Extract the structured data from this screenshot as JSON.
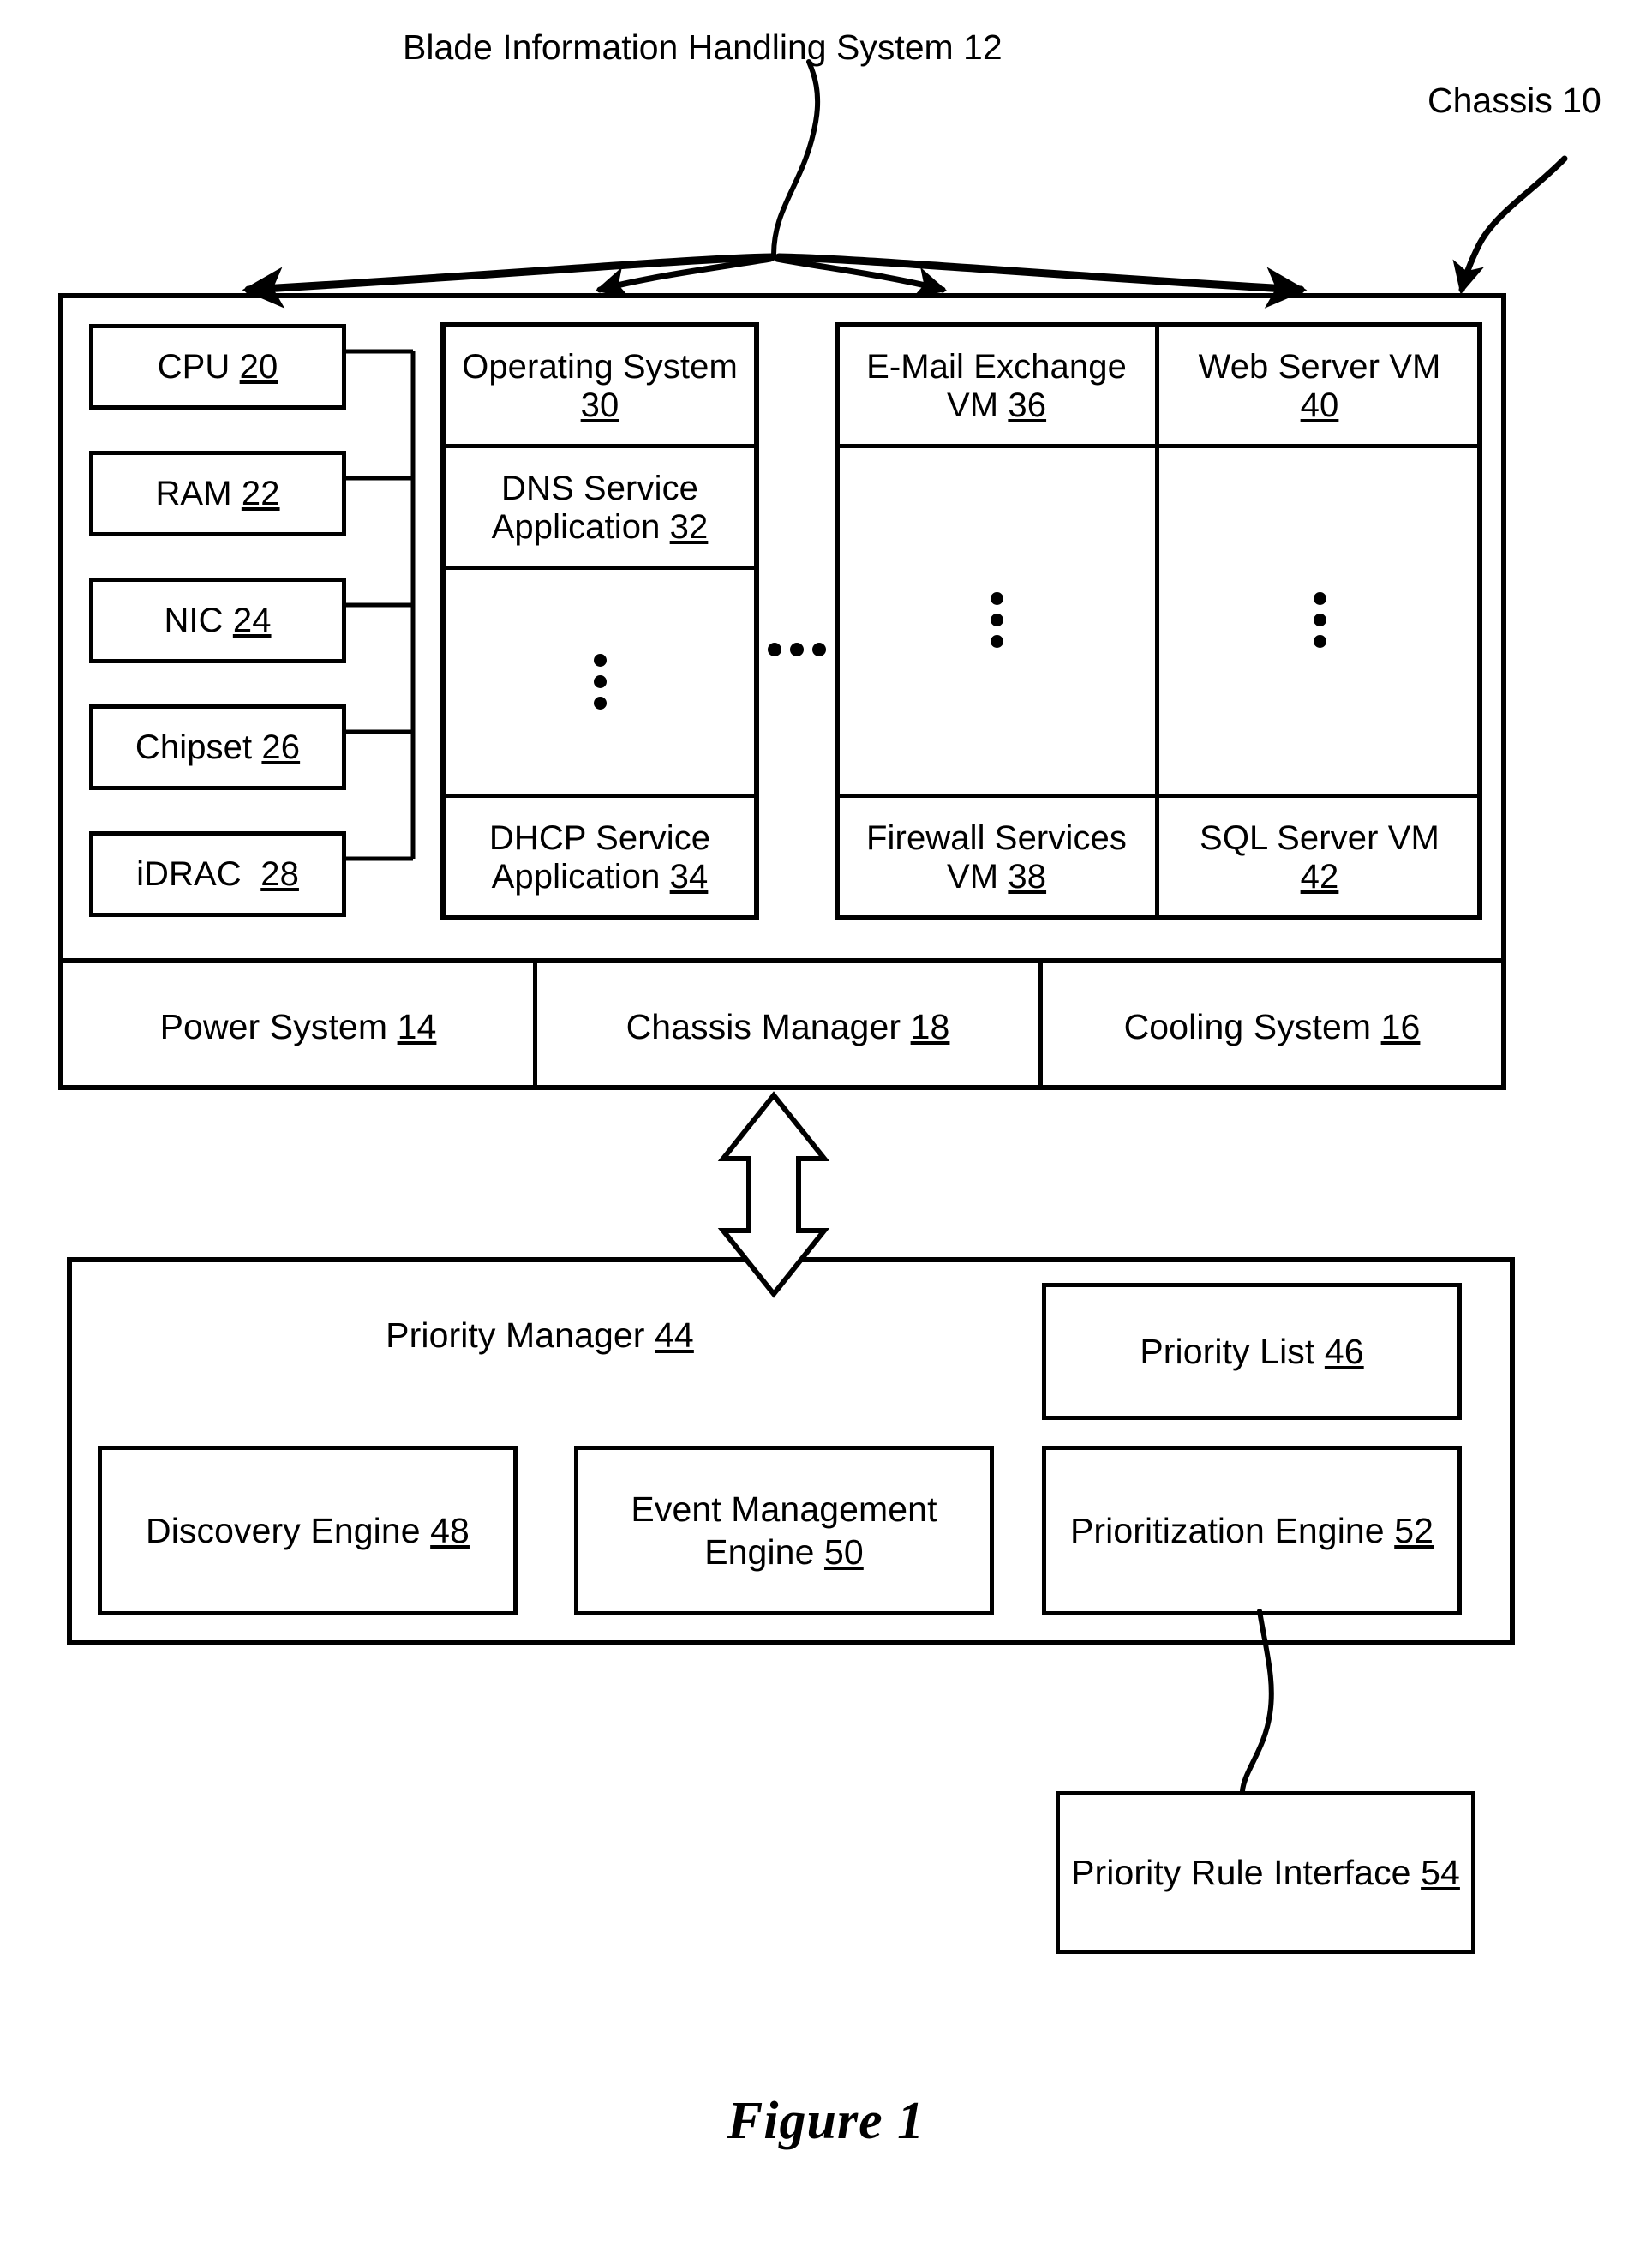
{
  "figure": {
    "caption": "Figure 1"
  },
  "callouts": {
    "blade_system": "Blade Information Handling System 12",
    "chassis": "Chassis 10"
  },
  "chassis": {
    "hardware_components": [
      {
        "label": "CPU",
        "ref": "20"
      },
      {
        "label": "RAM",
        "ref": "22"
      },
      {
        "label": "NIC",
        "ref": "24"
      },
      {
        "label": "Chipset",
        "ref": "26"
      },
      {
        "label": "iDRAC",
        "ref": "28"
      }
    ],
    "os_column": {
      "top": {
        "line1": "Operating System",
        "ref": "30"
      },
      "second": {
        "line1": "DNS Service",
        "line2": "Application",
        "ref": "32"
      },
      "ellipsis": "vertical-ellipsis",
      "bottom": {
        "line1": "DHCP Service",
        "line2": "Application",
        "ref": "34"
      }
    },
    "group_separator": "horizontal-ellipsis",
    "vm_columns": [
      {
        "top": {
          "line1": "E-Mail Exchange",
          "line2": "VM",
          "ref": "36"
        },
        "ellipsis": "vertical-ellipsis",
        "bottom": {
          "line1": "Firewall Services",
          "line2": "VM",
          "ref": "38"
        }
      },
      {
        "top": {
          "line1": "Web Server VM",
          "ref": "40"
        },
        "ellipsis": "vertical-ellipsis",
        "bottom": {
          "line1": "SQL Server VM",
          "ref": "42"
        }
      }
    ],
    "infrastructure": [
      {
        "label": "Power System",
        "ref": "14"
      },
      {
        "label": "Chassis Manager",
        "ref": "18"
      },
      {
        "label": "Cooling System",
        "ref": "16"
      }
    ]
  },
  "priority_manager": {
    "title": {
      "label": "Priority Manager",
      "ref": "44"
    },
    "priority_list": {
      "label": "Priority List",
      "ref": "46"
    },
    "engines": [
      {
        "line1": "Discovery Engine",
        "ref": "48"
      },
      {
        "line1": "Event Management",
        "line2": "Engine",
        "ref": "50"
      },
      {
        "line1": "Prioritization Engine",
        "ref": "52"
      }
    ]
  },
  "priority_rule_interface": {
    "label": "Priority Rule Interface",
    "ref": "54"
  },
  "connectors": {
    "chassis_to_priority_manager": "double-headed-vertical-arrow",
    "prioritization_to_rule_interface": "curved-leader-line",
    "blade_system_fanout": "four-curved-arrows",
    "chassis_leader": "curved-leader-arrow"
  }
}
